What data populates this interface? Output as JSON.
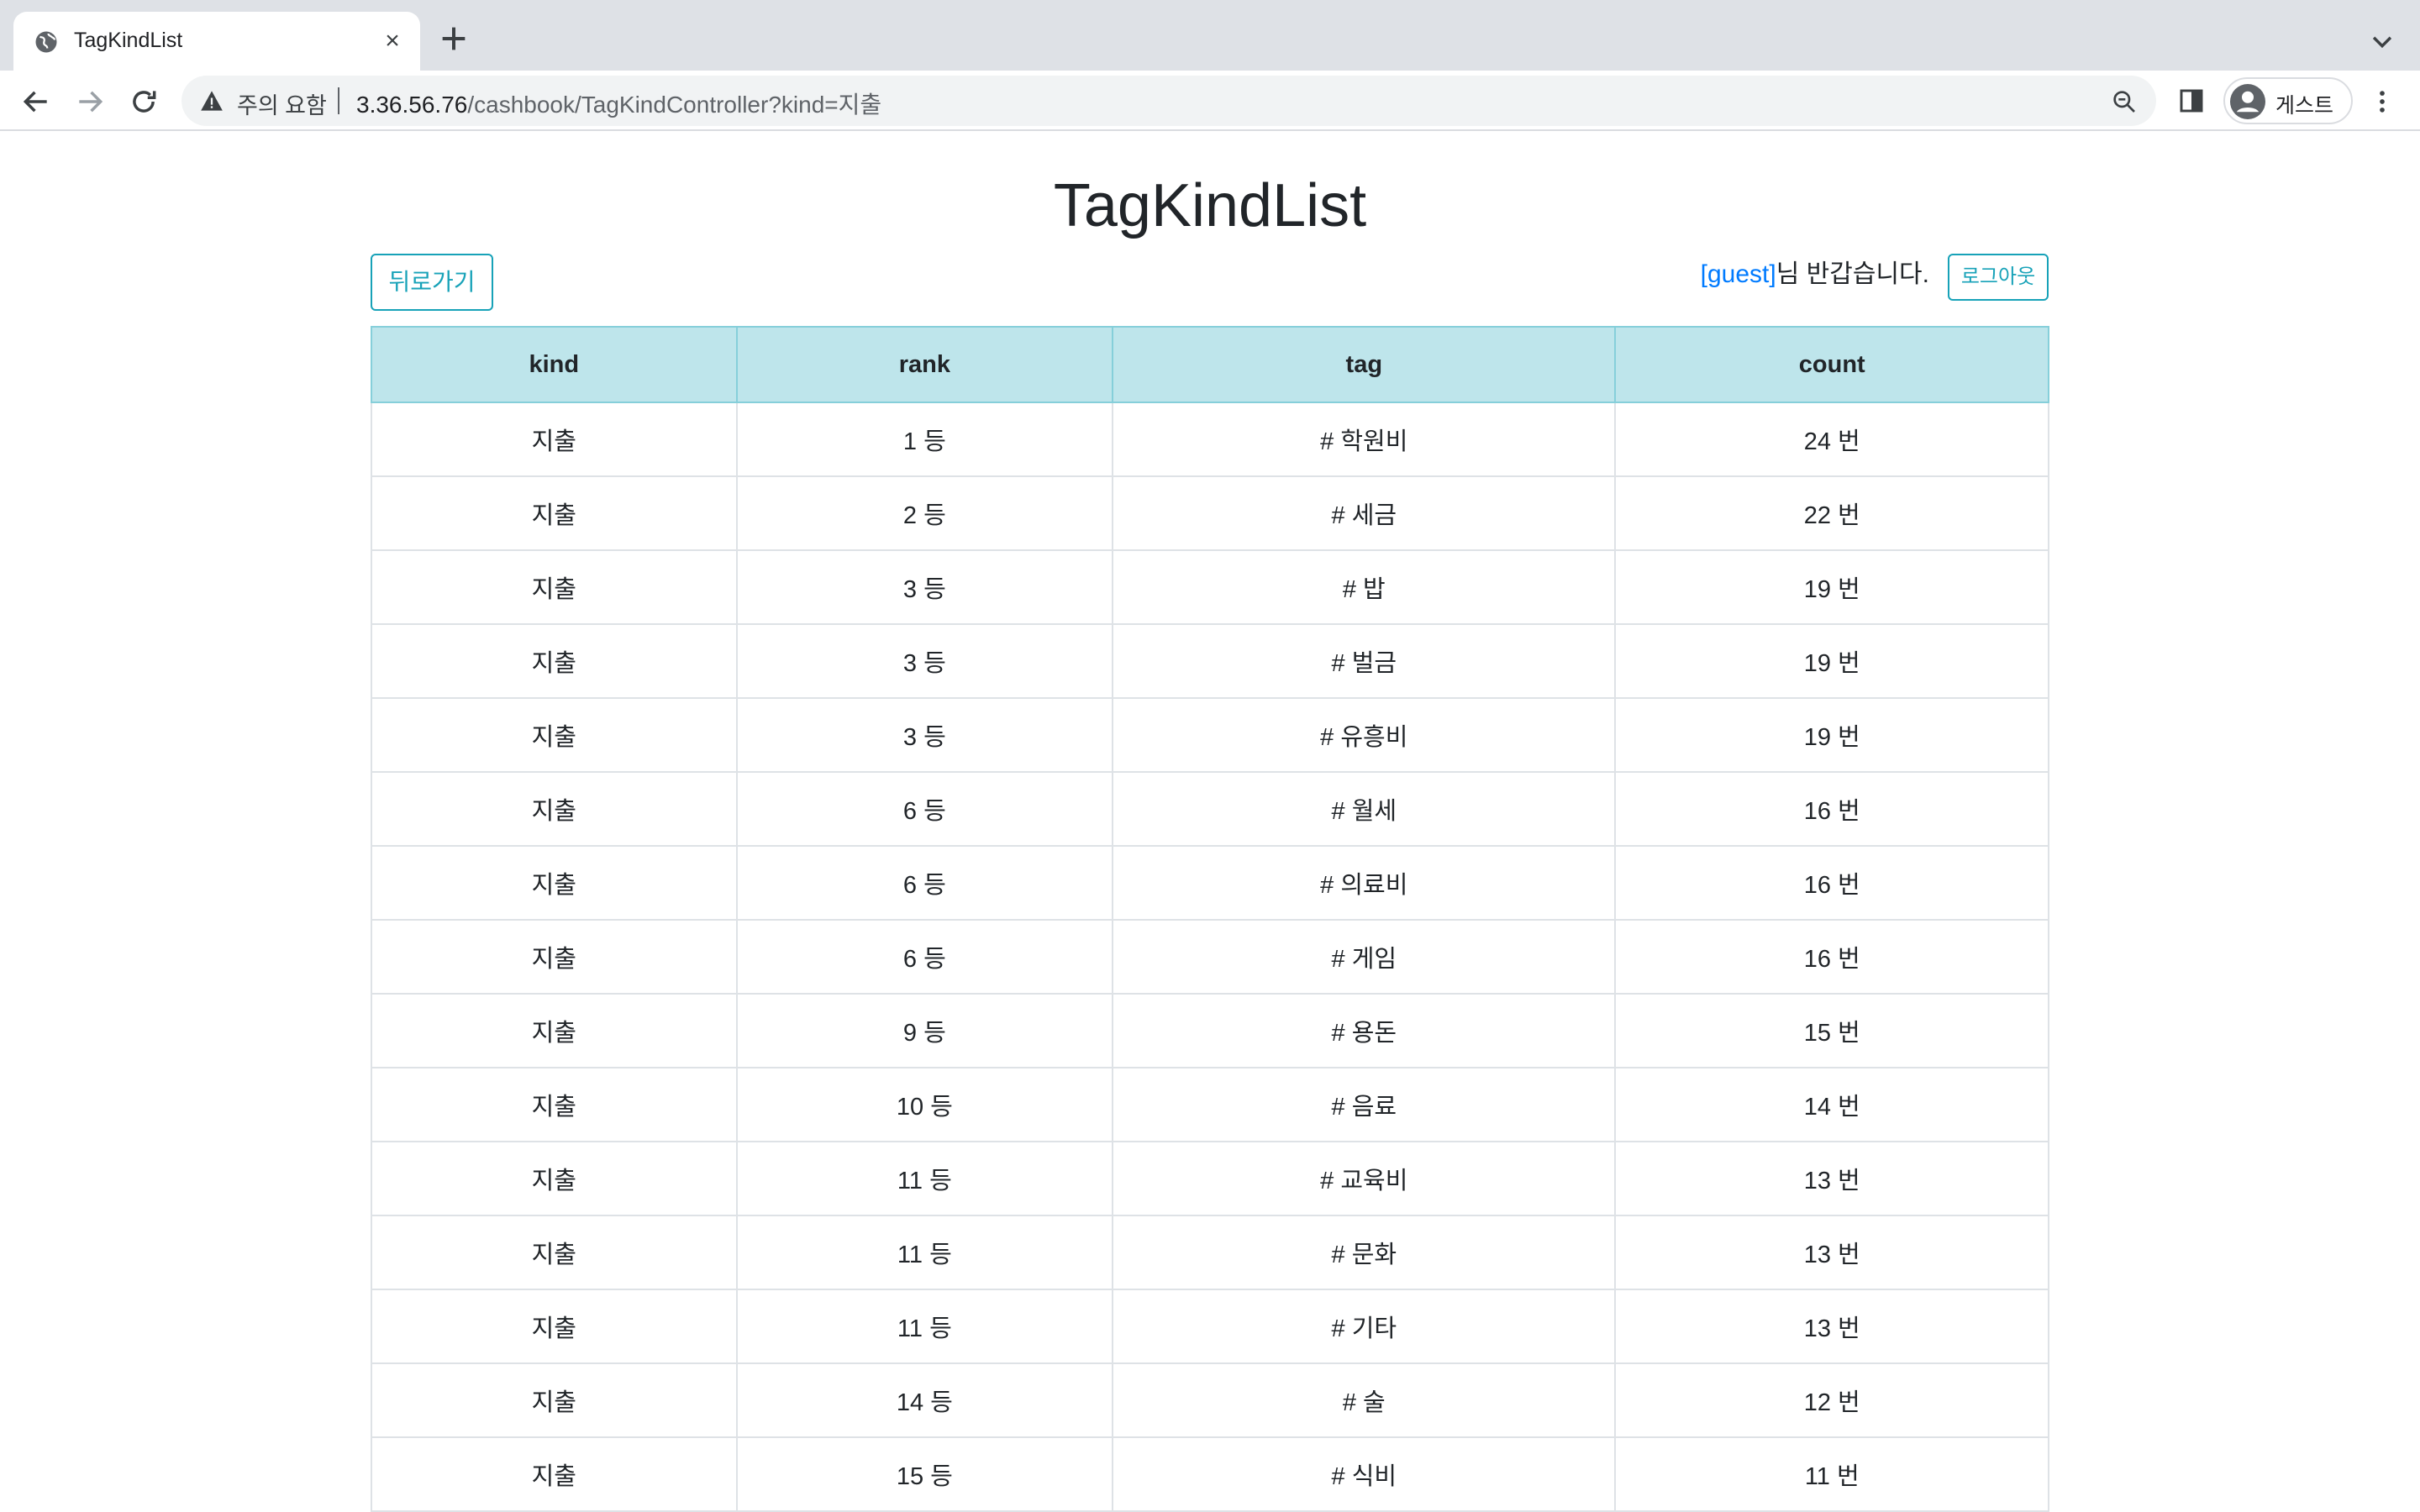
{
  "browser": {
    "tab_title": "TagKindList",
    "security_warning": "주의 요함",
    "url_host": "3.36.56.76",
    "url_path": "/cashbook/TagKindController?kind=지출",
    "profile_label": "게스트"
  },
  "page": {
    "title": "TagKindList",
    "back_button": "뒤로가기",
    "greeting_user": "[guest]",
    "greeting_text": "님 반갑습니다.",
    "logout_button": "로그아웃"
  },
  "table": {
    "headers": [
      "kind",
      "rank",
      "tag",
      "count"
    ],
    "rows": [
      [
        "지출",
        "1 등",
        "# 학원비",
        "24 번"
      ],
      [
        "지출",
        "2 등",
        "# 세금",
        "22 번"
      ],
      [
        "지출",
        "3 등",
        "# 밥",
        "19 번"
      ],
      [
        "지출",
        "3 등",
        "# 벌금",
        "19 번"
      ],
      [
        "지출",
        "3 등",
        "# 유흥비",
        "19 번"
      ],
      [
        "지출",
        "6 등",
        "# 월세",
        "16 번"
      ],
      [
        "지출",
        "6 등",
        "# 의료비",
        "16 번"
      ],
      [
        "지출",
        "6 등",
        "# 게임",
        "16 번"
      ],
      [
        "지출",
        "9 등",
        "# 용돈",
        "15 번"
      ],
      [
        "지출",
        "10 등",
        "# 음료",
        "14 번"
      ],
      [
        "지출",
        "11 등",
        "# 교육비",
        "13 번"
      ],
      [
        "지출",
        "11 등",
        "# 문화",
        "13 번"
      ],
      [
        "지출",
        "11 등",
        "# 기타",
        "13 번"
      ],
      [
        "지출",
        "14 등",
        "# 술",
        "12 번"
      ],
      [
        "지출",
        "15 등",
        "# 식비",
        "11 번"
      ]
    ]
  },
  "colors": {
    "accent": "#17a2b8",
    "header_bg": "#bee5eb",
    "link": "#007bff"
  },
  "icons": {
    "favicon": "globe-icon",
    "tab_close": "close-icon",
    "new_tab": "plus-icon",
    "back": "arrow-left-icon",
    "forward": "arrow-right-icon",
    "reload": "reload-icon",
    "warning": "warning-icon",
    "zoom": "zoom-icon",
    "side_panel": "side-panel-icon",
    "menu": "kebab-menu-icon"
  }
}
